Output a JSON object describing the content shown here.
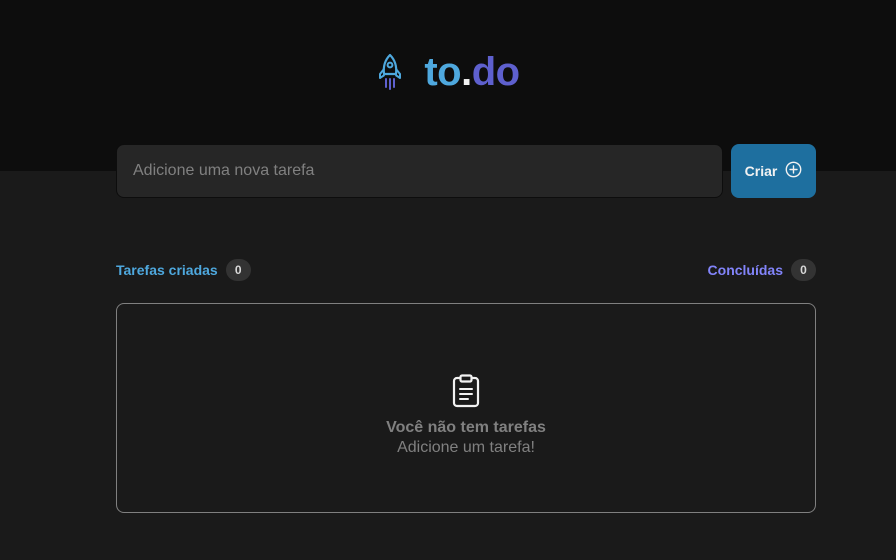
{
  "logo": {
    "part1": "to",
    "dot": ".",
    "part2": "do",
    "icon": "rocket-icon"
  },
  "new_task": {
    "placeholder": "Adicione uma nova tarefa",
    "value": "",
    "button_label": "Criar",
    "button_icon": "plus-circle-icon"
  },
  "counters": {
    "created_label": "Tarefas criadas",
    "created_count": "0",
    "done_label": "Concluídas",
    "done_count": "0"
  },
  "empty_state": {
    "icon": "clipboard-icon",
    "title": "Você não tem tarefas",
    "subtitle": "Adicione um tarefa!"
  },
  "colors": {
    "header_bg": "#0d0d0d",
    "page_bg": "#1a1a1a",
    "blue": "#4ea8de",
    "purple": "#5e60ce",
    "purple_light": "#8284fa",
    "button": "#1e6f9f"
  }
}
